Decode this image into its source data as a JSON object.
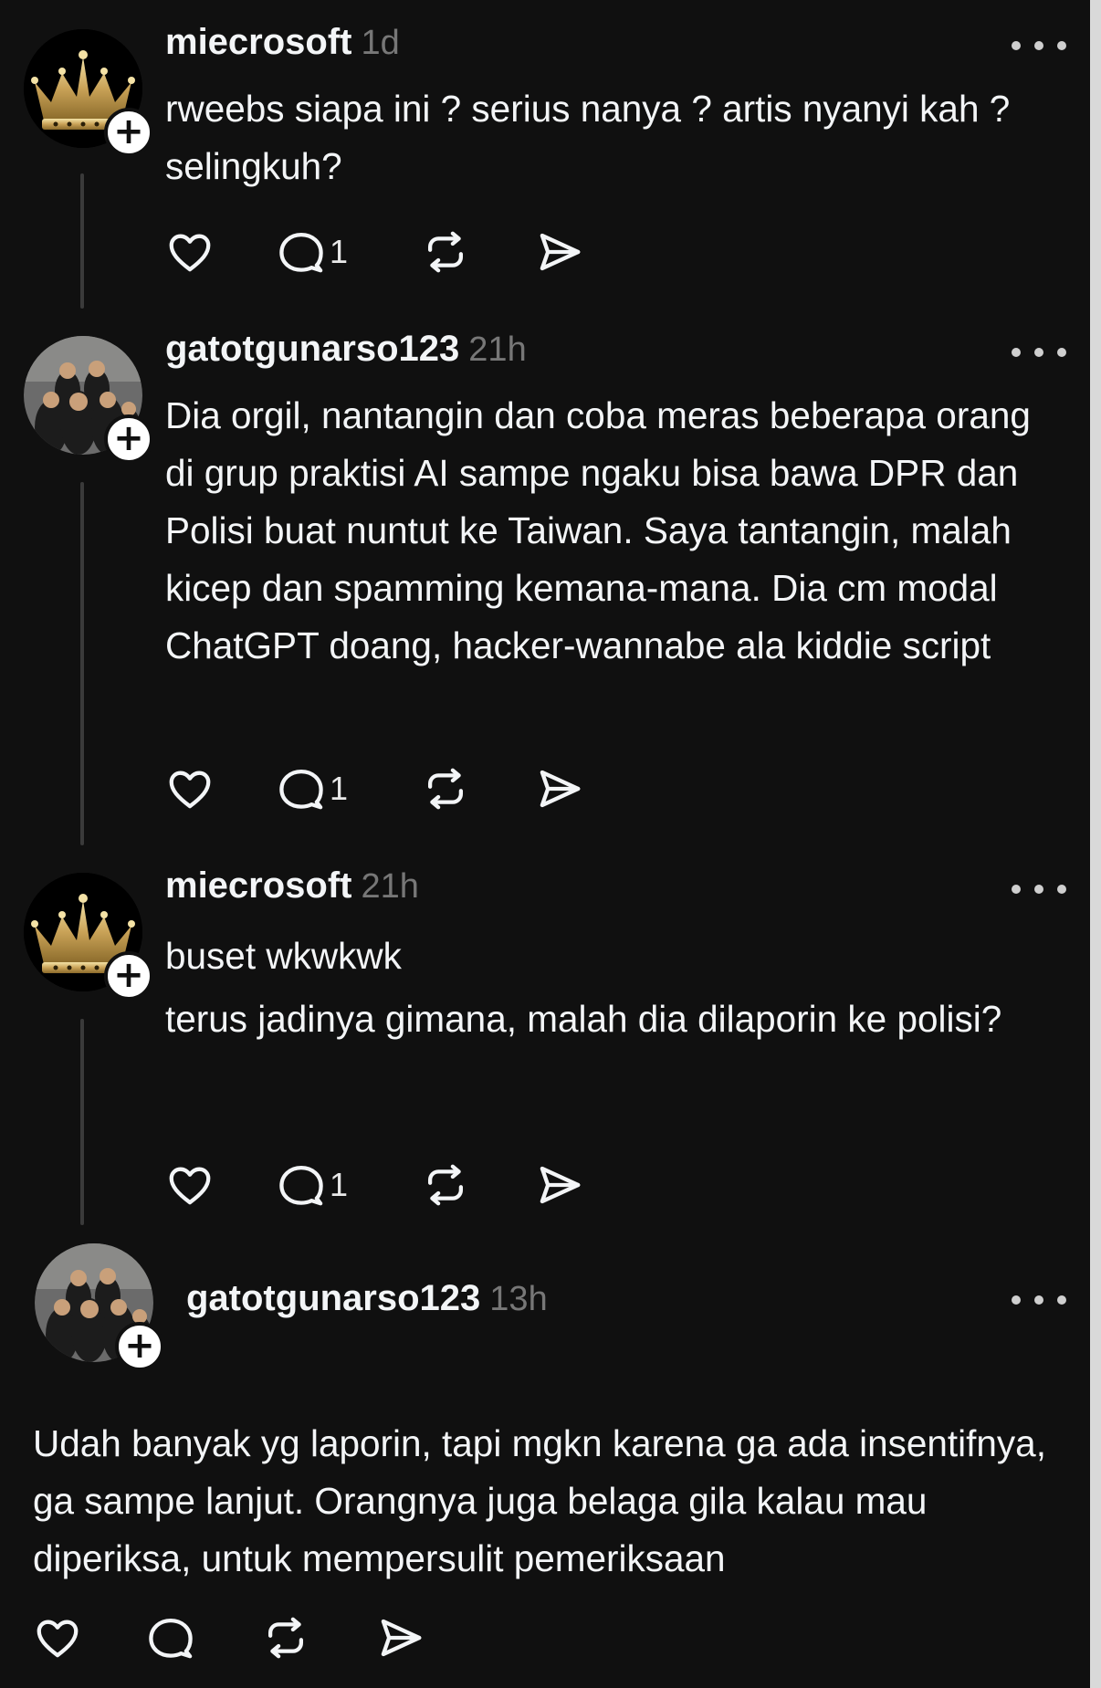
{
  "posts": [
    {
      "username": "miecrosoft",
      "time": "1d",
      "avatar": "crown-avatar",
      "lines": [
        "rweebs siapa ini ? serius nanya ? artis nyanyi kah ? selingkuh?"
      ],
      "reply_count": "1"
    },
    {
      "username": "gatotgunarso123",
      "time": "21h",
      "avatar": "group-photo-avatar",
      "lines": [
        "Dia orgil, nantangin dan coba meras beberapa orang di grup praktisi AI sampe ngaku bisa bawa DPR dan Polisi buat nuntut ke Taiwan. Saya tantangin, malah kicep dan spamming kemana-mana. Dia cm modal ChatGPT doang, hacker-wannabe ala kiddie script"
      ],
      "reply_count": "1"
    },
    {
      "username": "miecrosoft",
      "time": "21h",
      "avatar": "crown-avatar",
      "lines": [
        "buset wkwkwk",
        "terus jadinya gimana, malah dia dilaporin ke polisi?"
      ],
      "reply_count": "1"
    },
    {
      "username": "gatotgunarso123",
      "time": "13h",
      "avatar": "group-photo-avatar",
      "lines": [
        "Udah banyak yg laporin, tapi mgkn karena ga ada insentifnya, ga sampe lanjut. Orangnya juga belaga gila kalau mau diperiksa, untuk mempersulit pemeriksaan"
      ],
      "reply_count": ""
    }
  ],
  "icons": {
    "like": "heart-icon",
    "reply": "comment-icon",
    "repost": "repost-icon",
    "share": "send-icon",
    "more": "more-icon",
    "follow": "plus-icon"
  },
  "colors": {
    "background": "#101010",
    "text": "#f3f5f7",
    "muted": "#777777",
    "thread_line": "#3a3a3a"
  }
}
